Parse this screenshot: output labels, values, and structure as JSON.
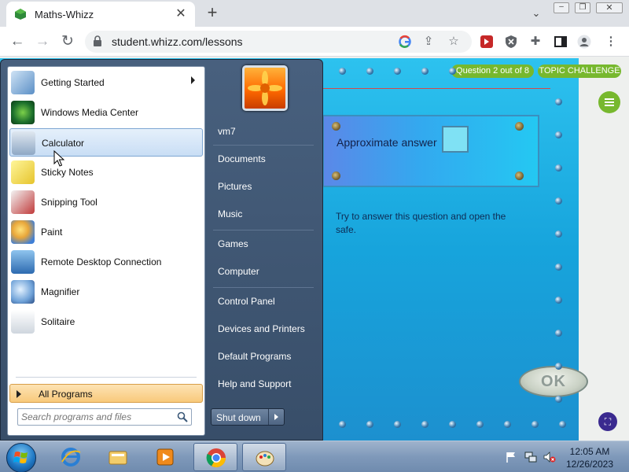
{
  "browser": {
    "tab_title": "Maths-Whizz",
    "tab_close_icon": "close-icon",
    "new_tab_label": "+",
    "url": "student.whizz.com/lessons",
    "nav_icons": [
      "back-icon",
      "forward-icon",
      "reload-icon"
    ],
    "omnibox_icons": [
      "google-icon",
      "share-icon",
      "bookmark-star-icon"
    ],
    "extension_icons": [
      "extension-icon",
      "shield-icon",
      "puzzle-icon",
      "sidepanel-icon",
      "profile-icon",
      "more-menu-icon"
    ]
  },
  "game": {
    "question_progress": "Question 2 out of 8",
    "challenge_label": "TOPIC CHALLENGE",
    "answer_label": "Approximate answer",
    "answer_value": "",
    "instruction": "Try to answer this question and open the safe.",
    "ok_label": "OK",
    "accent_green": "#77b82e",
    "panel_blue": "#17a4dc"
  },
  "start_menu": {
    "programs": [
      {
        "label": "Getting Started",
        "icon": "getting-started-icon",
        "has_submenu": true
      },
      {
        "label": "Windows Media Center",
        "icon": "media-center-icon",
        "has_submenu": false
      },
      {
        "label": "Calculator",
        "icon": "calculator-icon",
        "has_submenu": false,
        "highlighted": true
      },
      {
        "label": "Sticky Notes",
        "icon": "sticky-notes-icon",
        "has_submenu": false
      },
      {
        "label": "Snipping Tool",
        "icon": "snipping-tool-icon",
        "has_submenu": false
      },
      {
        "label": "Paint",
        "icon": "paint-icon",
        "has_submenu": false
      },
      {
        "label": "Remote Desktop Connection",
        "icon": "remote-desktop-icon",
        "has_submenu": false
      },
      {
        "label": "Magnifier",
        "icon": "magnifier-icon",
        "has_submenu": false
      },
      {
        "label": "Solitaire",
        "icon": "solitaire-icon",
        "has_submenu": false
      }
    ],
    "all_programs_label": "All Programs",
    "search_placeholder": "Search programs and files",
    "user_name": "vm7",
    "places": [
      "Documents",
      "Pictures",
      "Music"
    ],
    "places2": [
      "Games",
      "Computer"
    ],
    "system": [
      "Control Panel",
      "Devices and Printers",
      "Default Programs",
      "Help and Support"
    ],
    "shutdown_label": "Shut down"
  },
  "taskbar": {
    "pinned": [
      "internet-explorer-icon",
      "windows-explorer-icon",
      "media-player-icon",
      "chrome-icon",
      "paint-icon"
    ],
    "tray_icons": [
      "action-center-flag-icon",
      "network-icon",
      "volume-muted-icon"
    ],
    "time": "12:05 AM",
    "date": "12/26/2023"
  }
}
